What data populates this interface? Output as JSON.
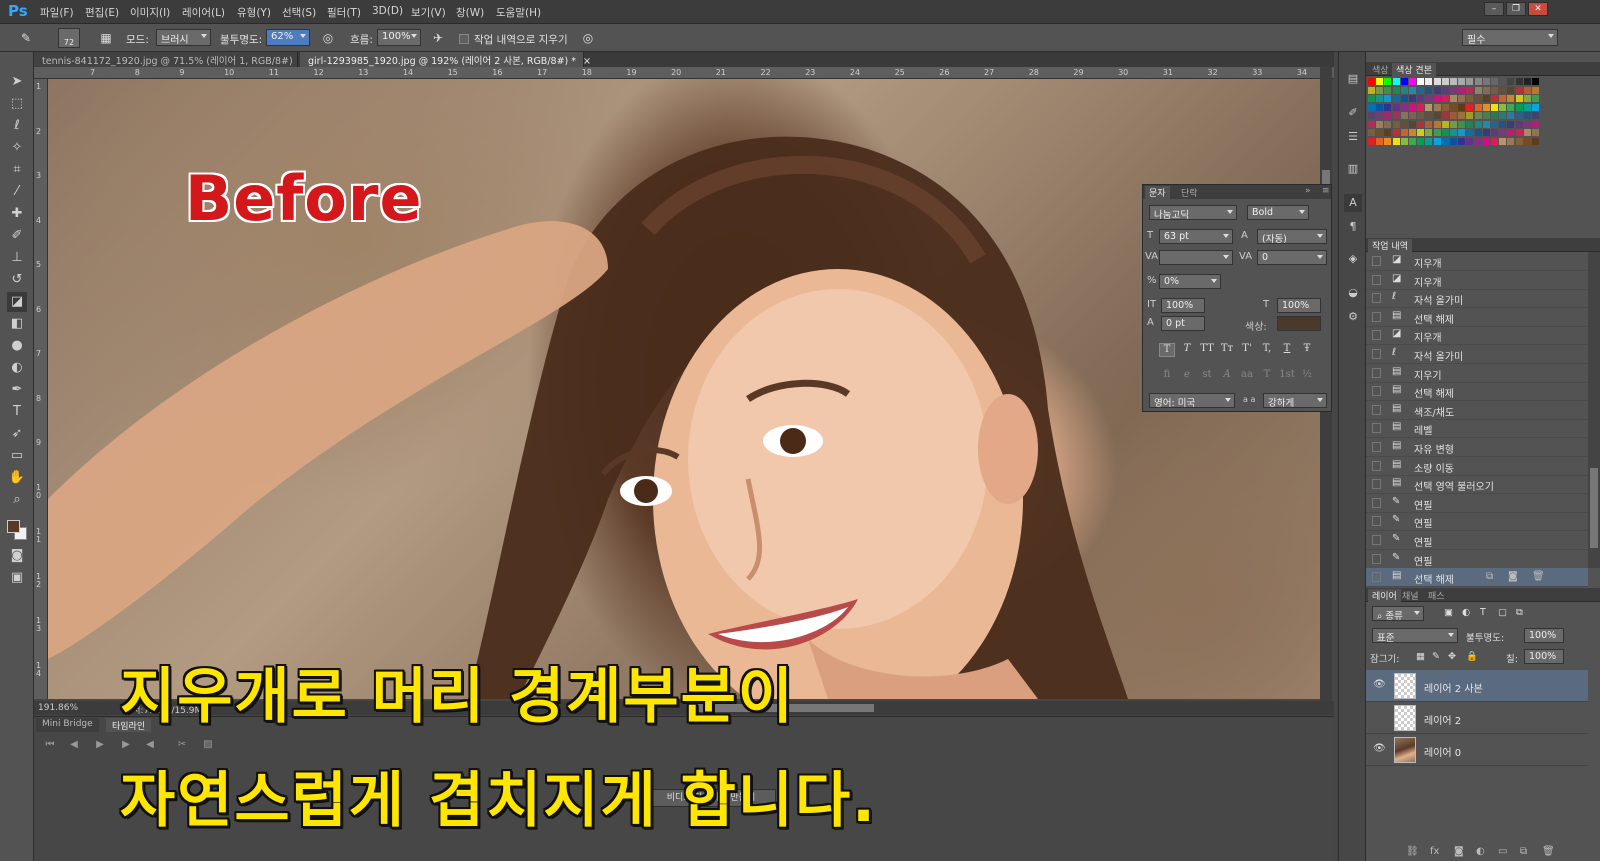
{
  "app": {
    "logo": "Ps"
  },
  "menu": [
    "파일(F)",
    "편집(E)",
    "이미지(I)",
    "레이어(L)",
    "유형(Y)",
    "선택(S)",
    "필터(T)",
    "3D(D)",
    "보기(V)",
    "창(W)",
    "도움말(H)"
  ],
  "window_buttons": [
    "–",
    "❐",
    "✕"
  ],
  "options": {
    "brush_size": "72",
    "mode_label": "모드:",
    "mode_value": "브러시",
    "opacity_label": "불투명도:",
    "opacity_value": "62%",
    "flow_label": "흐름:",
    "flow_value": "100%",
    "erase_history_label": "작업 내역으로 지우기",
    "workspace": "필수"
  },
  "tabs": [
    {
      "label": "tennis-841172_1920.jpg @ 71.5% (레이어 1, RGB/8#)",
      "close": "×"
    },
    {
      "label": "girl-1293985_1920.jpg @ 192% (레이어 2 사본, RGB/8#) *",
      "close": "×"
    }
  ],
  "ruler_top": [
    "7",
    "8",
    "9",
    "10",
    "11",
    "12",
    "13",
    "14",
    "15",
    "16",
    "17",
    "18",
    "19",
    "20",
    "21",
    "22",
    "23",
    "24",
    "25",
    "26",
    "27",
    "28",
    "29",
    "30",
    "31",
    "32",
    "33",
    "34"
  ],
  "ruler_left": [
    "1",
    "2",
    "3",
    "4",
    "5",
    "6",
    "7",
    "8",
    "9",
    "1 0",
    "1 1",
    "1 2",
    "1 3",
    "1 4"
  ],
  "status": {
    "zoom": "191.86%",
    "doc": "문서:7.91M/15.9M"
  },
  "overlay": {
    "before": "Before",
    "caption_line1": "지우개로 머리 경계부분이",
    "caption_line2": "자연스럽게 겹치지게 합니다."
  },
  "timeline": {
    "tabs": [
      "Mini Bridge",
      "타임라인"
    ],
    "button": "비디오 타임라인 만들기"
  },
  "character": {
    "tabs": [
      "문자",
      "단락"
    ],
    "font_family": "나눔고딕",
    "font_style": "Bold",
    "size": "63 pt",
    "leading": "(자동)",
    "kerning": "",
    "tracking": "0",
    "scale_pct": "0%",
    "vscale": "100%",
    "hscale": "100%",
    "baseline": "0 pt",
    "color_label": "색상:",
    "text_color": "#4b3a2c",
    "style_buttons": [
      "T",
      "T",
      "TT",
      "Tт",
      "T'",
      "T,",
      "T",
      "Ŧ"
    ],
    "ot_buttons": [
      "fi",
      "ℯ",
      "st",
      "A",
      "aa",
      "T",
      "1st",
      "½"
    ],
    "language": "영어: 미국",
    "aa_label": "a a",
    "antialias": "강하게"
  },
  "swatches_panel": {
    "tabs": [
      "색상",
      "색상 견본"
    ]
  },
  "history": {
    "tab": "작업 내역",
    "items": [
      {
        "label": "지우개",
        "icon": "eraser-icon"
      },
      {
        "label": "지우개",
        "icon": "eraser-icon"
      },
      {
        "label": "자석 올가미",
        "icon": "magnetic-lasso-icon"
      },
      {
        "label": "선택 해제",
        "icon": "document-icon"
      },
      {
        "label": "지우개",
        "icon": "eraser-icon"
      },
      {
        "label": "자석 올가미",
        "icon": "magnetic-lasso-icon"
      },
      {
        "label": "지우기",
        "icon": "document-icon"
      },
      {
        "label": "선택 해제",
        "icon": "document-icon"
      },
      {
        "label": "색조/채도",
        "icon": "document-icon"
      },
      {
        "label": "레벨",
        "icon": "document-icon"
      },
      {
        "label": "자유 변형",
        "icon": "document-icon"
      },
      {
        "label": "소량 이동",
        "icon": "document-icon"
      },
      {
        "label": "선택 영역 불러오기",
        "icon": "document-icon"
      },
      {
        "label": "연필",
        "icon": "pencil-icon"
      },
      {
        "label": "연필",
        "icon": "pencil-icon"
      },
      {
        "label": "연필",
        "icon": "pencil-icon"
      },
      {
        "label": "연필",
        "icon": "pencil-icon"
      },
      {
        "label": "선택 해제",
        "icon": "document-icon"
      }
    ]
  },
  "layers": {
    "tabs": [
      "레이어",
      "채널",
      "패스"
    ],
    "kind_filter": "종류",
    "blend_mode": "표준",
    "opacity_label": "불투명도:",
    "opacity": "100%",
    "lock_label": "잠그기:",
    "fill_label": "칠:",
    "fill": "100%",
    "items": [
      {
        "name": "레이어 2 사본",
        "visible": true,
        "selected": true,
        "thumb": "transparent"
      },
      {
        "name": "레이어 2",
        "visible": false,
        "selected": false,
        "thumb": "transparent"
      },
      {
        "name": "레이어 0",
        "visible": true,
        "selected": false,
        "thumb": "photo"
      }
    ]
  }
}
